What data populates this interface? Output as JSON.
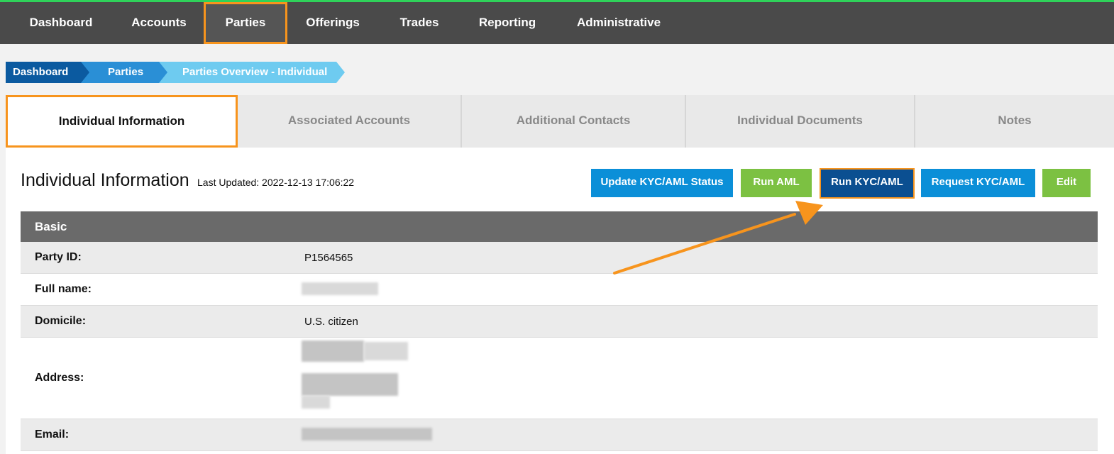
{
  "nav": {
    "items": [
      {
        "label": "Dashboard"
      },
      {
        "label": "Accounts"
      },
      {
        "label": "Parties"
      },
      {
        "label": "Offerings"
      },
      {
        "label": "Trades"
      },
      {
        "label": "Reporting"
      },
      {
        "label": "Administrative"
      }
    ],
    "active": "Parties"
  },
  "breadcrumb": [
    {
      "label": "Dashboard"
    },
    {
      "label": "Parties"
    },
    {
      "label": "Parties Overview - Individual"
    }
  ],
  "tabs": [
    {
      "label": "Individual Information"
    },
    {
      "label": "Associated Accounts"
    },
    {
      "label": "Additional Contacts"
    },
    {
      "label": "Individual Documents"
    },
    {
      "label": "Notes"
    }
  ],
  "main": {
    "title": "Individual Information",
    "last_updated": "Last Updated: 2022-12-13 17:06:22",
    "buttons": {
      "update_status": "Update KYC/AML Status",
      "run_aml": "Run AML",
      "run_kyc_aml": "Run KYC/AML",
      "request_kyc_aml": "Request KYC/AML",
      "edit": "Edit"
    },
    "section": "Basic",
    "fields": {
      "party_id": {
        "label": "Party ID:",
        "value": "P1564565"
      },
      "full_name": {
        "label": "Full name:"
      },
      "domicile": {
        "label": "Domicile:",
        "value": "U.S. citizen"
      },
      "address": {
        "label": "Address:"
      },
      "email": {
        "label": "Email:"
      }
    }
  },
  "colors": {
    "nav_bg": "#4a4a4a",
    "highlight": "#f7941d",
    "primary_blue": "#0b8fd8",
    "dark_blue": "#0b4f91",
    "green": "#7cc142"
  }
}
